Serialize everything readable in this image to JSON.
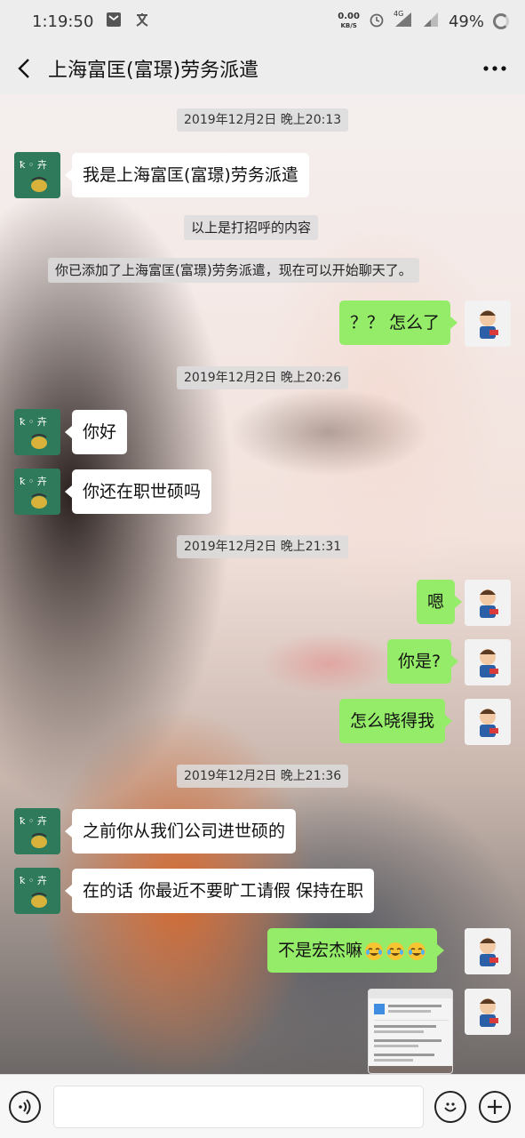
{
  "status_bar": {
    "time": "1:19:50",
    "net_speed_value": "0.00",
    "net_speed_unit": "KB/S",
    "signal_label": "4G",
    "battery": "49%"
  },
  "nav": {
    "title": "上海富匡(富璟)劳务派遣"
  },
  "messages": [
    {
      "kind": "timestamp",
      "text": "2019年12月2日 晚上20:13"
    },
    {
      "kind": "received",
      "text": "我是上海富匡(富璟)劳务派遣"
    },
    {
      "kind": "system",
      "text": "以上是打招呼的内容"
    },
    {
      "kind": "system",
      "text": "你已添加了上海富匡(富璟)劳务派遣，现在可以开始聊天了。"
    },
    {
      "kind": "sent",
      "text": "？？ 怎么了"
    },
    {
      "kind": "timestamp",
      "text": "2019年12月2日 晚上20:26"
    },
    {
      "kind": "received",
      "text": "你好"
    },
    {
      "kind": "received",
      "text": "你还在职世硕吗"
    },
    {
      "kind": "timestamp",
      "text": "2019年12月2日 晚上21:31"
    },
    {
      "kind": "sent",
      "text": "嗯"
    },
    {
      "kind": "sent",
      "text": "你是?"
    },
    {
      "kind": "sent",
      "text": "怎么晓得我"
    },
    {
      "kind": "timestamp",
      "text": "2019年12月2日 晚上21:36"
    },
    {
      "kind": "received",
      "text": "之前你从我们公司进世硕的"
    },
    {
      "kind": "received",
      "text": "在的话 你最近不要旷工请假 保持在职"
    },
    {
      "kind": "sent",
      "text": "不是宏杰嘛",
      "emoji": [
        "crying-laughing",
        "crying-laughing",
        "crying-laughing"
      ]
    },
    {
      "kind": "sent-image",
      "image": "screenshot-thumbnail"
    }
  ],
  "input_bar": {
    "placeholder": "",
    "value": ""
  },
  "colors": {
    "sent_bubble": "#95ec69",
    "received_bubble": "#ffffff",
    "bar_background": "#ededed"
  }
}
